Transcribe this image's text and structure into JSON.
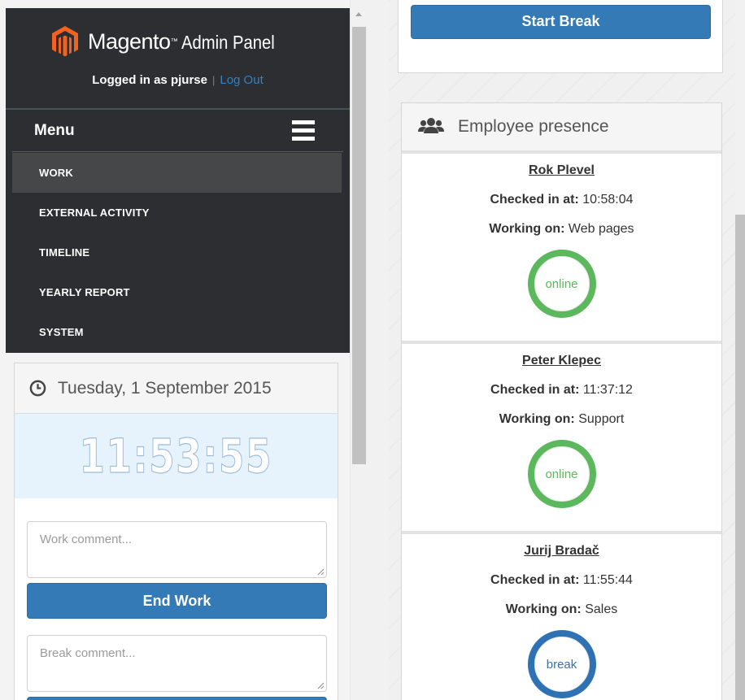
{
  "header": {
    "brand_name": "Magento",
    "brand_tm": "™",
    "brand_sub": "Admin Panel",
    "logged_in_prefix": "Logged in as",
    "username": "pjurse",
    "separator": "|",
    "logout_label": "Log Out"
  },
  "menu": {
    "title": "Menu",
    "items": [
      {
        "label": "WORK",
        "active": true
      },
      {
        "label": "EXTERNAL ACTIVITY",
        "active": false
      },
      {
        "label": "TIMELINE",
        "active": false
      },
      {
        "label": "YEARLY REPORT",
        "active": false
      },
      {
        "label": "SYSTEM",
        "active": false
      }
    ]
  },
  "clock": {
    "date": "Tuesday, 1 September 2015",
    "time": "11:53:55",
    "work_comment_placeholder": "Work comment...",
    "end_work_label": "End Work",
    "break_comment_placeholder": "Break comment..."
  },
  "break_panel": {
    "start_break_label": "Start Break"
  },
  "presence": {
    "title": "Employee presence",
    "checked_in_label": "Checked in at:",
    "working_on_label": "Working on:",
    "employees": [
      {
        "name": "Rok Plevel",
        "checked_in": "10:58:04",
        "working_on": "Web pages",
        "status": "online"
      },
      {
        "name": "Peter Klepec",
        "checked_in": "11:37:12",
        "working_on": "Support",
        "status": "online"
      },
      {
        "name": "Jurij Bradač",
        "checked_in": "11:55:44",
        "working_on": "Sales",
        "status": "break"
      }
    ]
  },
  "colors": {
    "sidebar_bg": "#2d2e31",
    "primary_button": "#337ab7",
    "link": "#2f82c7",
    "status_online": "#5cb85c",
    "status_break": "#2f72b3",
    "clock_bg": "#e6f2fc"
  },
  "icons": {
    "brand": "magento-logo-icon",
    "menu": "hamburger-icon",
    "clock": "clock-icon",
    "presence": "users-icon"
  }
}
